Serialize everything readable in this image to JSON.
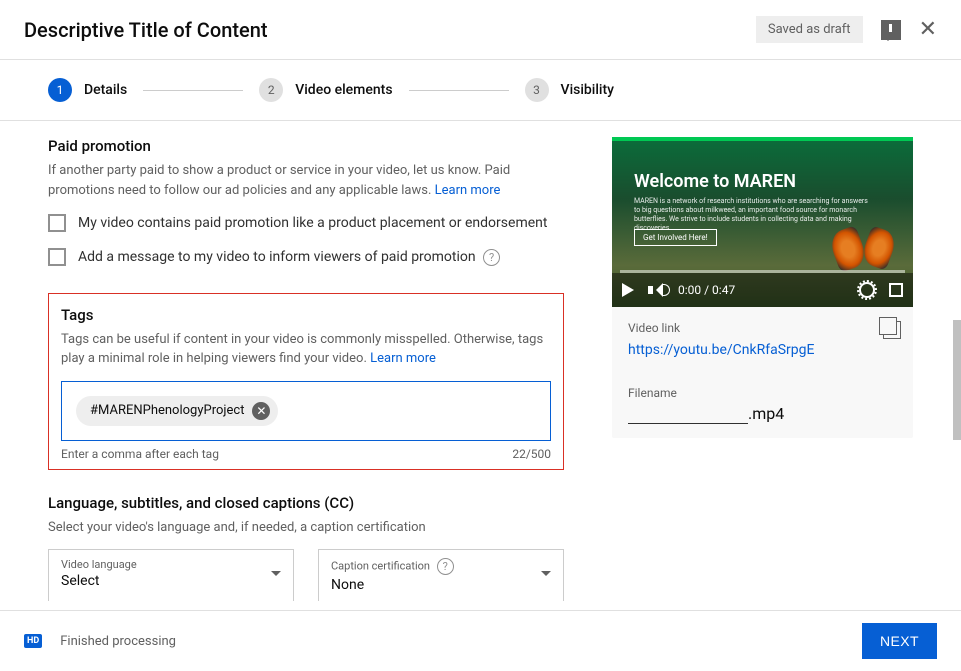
{
  "header": {
    "title": "Descriptive Title of Content",
    "draft_status": "Saved as draft"
  },
  "stepper": {
    "steps": [
      {
        "num": "1",
        "label": "Details"
      },
      {
        "num": "2",
        "label": "Video elements"
      },
      {
        "num": "3",
        "label": "Visibility"
      }
    ]
  },
  "paid_promotion": {
    "title": "Paid promotion",
    "desc": "If another party paid to show a product or service in your video, let us know. Paid promotions need to follow our ad policies and any applicable laws.",
    "learn_more": "Learn more",
    "cb1": "My video contains paid promotion like a product placement or endorsement",
    "cb2": "Add a message to my video to inform viewers of paid promotion"
  },
  "tags": {
    "title": "Tags",
    "desc": "Tags can be useful if content in your video is commonly misspelled. Otherwise, tags play a minimal role in helping viewers find your video.",
    "learn_more": "Learn more",
    "chip": "#MARENPhenologyProject",
    "hint": "Enter a comma after each tag",
    "counter": "22/500"
  },
  "language": {
    "title": "Language, subtitles, and closed captions (CC)",
    "desc": "Select your video's language and, if needed, a caption certification",
    "lang_label": "Video language",
    "lang_value": "Select",
    "cc_label": "Caption certification",
    "cc_value": "None"
  },
  "preview": {
    "thumb_title": "Welcome to MAREN",
    "time": "0:00 / 0:47",
    "link_label": "Video link",
    "link": "https://youtu.be/CnkRfaSrpgE",
    "filename_label": "Filename",
    "filename_ext": ".mp4"
  },
  "footer": {
    "hd": "HD",
    "status": "Finished processing",
    "next": "NEXT"
  }
}
